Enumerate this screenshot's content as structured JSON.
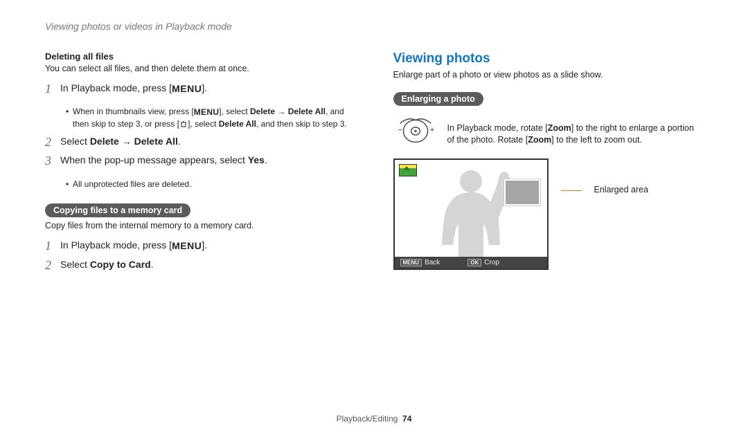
{
  "top_title": "Viewing photos or videos in Playback mode",
  "left": {
    "deleting_heading": "Deleting all files",
    "deleting_body": "You can select all files, and then delete them at once.",
    "steps_a": {
      "s1_prefix": "In Playback mode, press [",
      "s1_menu": "MENU",
      "s1_suffix": "].",
      "s1_bullet_a": "When in thumbnails view, press [",
      "s1_bullet_menu": "MENU",
      "s1_bullet_b": "], select ",
      "s1_bullet_del": "Delete",
      "s1_bullet_arrow": " → ",
      "s1_bullet_delall": "Delete All",
      "s1_bullet_tail1": ", and then skip to step 3, or press [",
      "s1_bullet_tail2": "], select ",
      "s1_bullet_delall2": "Delete All",
      "s1_bullet_tail3": ", and then skip to step 3.",
      "s2_prefix": "Select ",
      "s2_del": "Delete",
      "s2_arrow": " → ",
      "s2_delall": "Delete All",
      "s2_suffix": ".",
      "s3_prefix": "When the pop-up message appears, select ",
      "s3_yes": "Yes",
      "s3_suffix": ".",
      "s3_bullet": "All unprotected files are deleted."
    },
    "copy_pill": "Copying files to a memory card",
    "copy_body": "Copy files from the internal memory to a memory card.",
    "steps_b": {
      "s1_prefix": "In Playback mode, press [",
      "s1_menu": "MENU",
      "s1_suffix": "].",
      "s2_prefix": "Select ",
      "s2_bold": "Copy to Card",
      "s2_suffix": "."
    }
  },
  "right": {
    "section_heading": "Viewing photos",
    "section_body": "Enlarge part of a photo or view photos as a slide show.",
    "enlarging_pill": "Enlarging a photo",
    "zoom_text_a": "In Playback mode, rotate [",
    "zoom_word1": "Zoom",
    "zoom_text_b": "] to the right to enlarge a portion of the photo. Rotate [",
    "zoom_word2": "Zoom",
    "zoom_text_c": "] to the left to zoom out.",
    "callout": "Enlarged area",
    "footer_menu": "MENU",
    "footer_back": "Back",
    "footer_ok": "OK",
    "footer_crop": "Crop"
  },
  "footer": {
    "label": "Playback/Editing",
    "page": "74"
  }
}
